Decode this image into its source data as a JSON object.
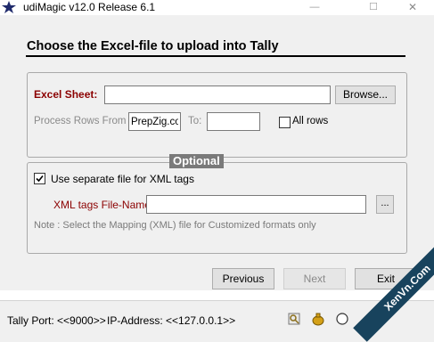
{
  "window": {
    "title": "udiMagic v12.0 Release 6.1",
    "minimize_glyph": "—",
    "maximize_glyph": "☐",
    "close_glyph": "✕"
  },
  "heading": "Choose the Excel-file to upload into Tally",
  "excel": {
    "label": "Excel Sheet:",
    "value": "",
    "browse_label": "Browse...",
    "rows_from_label": "Process Rows From :",
    "rows_from_value": "PrepZig.com",
    "to_label": "To:",
    "to_value": "",
    "all_rows_label": "All rows",
    "all_rows_checked": false
  },
  "optional": {
    "legend": "Optional",
    "separate_file_label": "Use separate file for XML tags",
    "separate_file_checked": true,
    "xml_label": "XML tags File-Name:",
    "xml_value": "",
    "ellipsis_label": "...",
    "note": "Note : Select the Mapping (XML) file for Customized formats only"
  },
  "nav": {
    "previous_label": "Previous",
    "next_label": "Next",
    "exit_label": "Exit"
  },
  "status": {
    "tally_port": "Tally Port: <<9000>>",
    "ip_address": "IP-Address: <<127.0.0.1>>"
  },
  "watermark": "XenVn.Com",
  "colors": {
    "label_red": "#8b0000",
    "legend_bg": "#7a7a7a",
    "watermark_bg": "#18435d"
  }
}
